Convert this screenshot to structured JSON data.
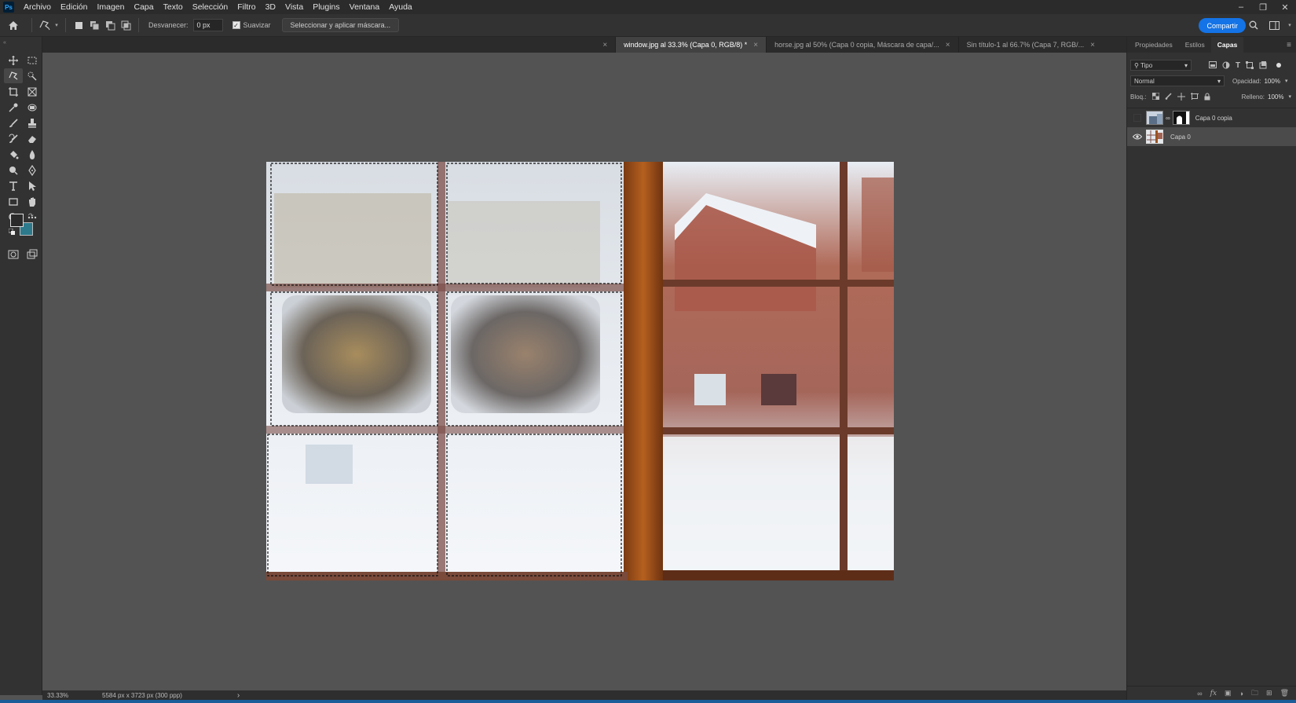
{
  "menubar": {
    "logo": "Ps",
    "items": [
      "Archivo",
      "Edición",
      "Imagen",
      "Capa",
      "Texto",
      "Selección",
      "Filtro",
      "3D",
      "Vista",
      "Plugins",
      "Ventana",
      "Ayuda"
    ]
  },
  "options": {
    "feather_label": "Desvanecer:",
    "feather_value": "0 px",
    "antialias_label": "Suavizar",
    "select_mask_label": "Seleccionar y aplicar máscara...",
    "share_label": "Compartir"
  },
  "tabs": [
    {
      "label": "window.jpg al 33.3% (Capa 0, RGB/8) *",
      "active": true
    },
    {
      "label": "horse.jpg al 50% (Capa 0 copia, Máscara de capa/...",
      "active": false
    },
    {
      "label": "Sin título-1 al 66.7% (Capa 7, RGB/...",
      "active": false
    }
  ],
  "panel": {
    "tabs": [
      "Propiedades",
      "Estilos",
      "Capas"
    ],
    "filter_label": "Tipo",
    "blend_mode": "Normal",
    "opacity_label": "Opacidad:",
    "opacity_value": "100%",
    "lock_label": "Bloq.:",
    "fill_label": "Relleno:",
    "fill_value": "100%",
    "layers": [
      {
        "name": "Capa 0 copia",
        "visible": false,
        "selected": false
      },
      {
        "name": "Capa 0",
        "visible": true,
        "selected": true
      }
    ]
  },
  "status": {
    "zoom": "33.33%",
    "doc_info": "5584 px x 3723 px (300 ppp)",
    "arrow": "›"
  },
  "colors": {
    "accent": "#1473e6",
    "foreground_swatch": "#2a2a2a",
    "background_swatch": "#2c7a8c"
  }
}
